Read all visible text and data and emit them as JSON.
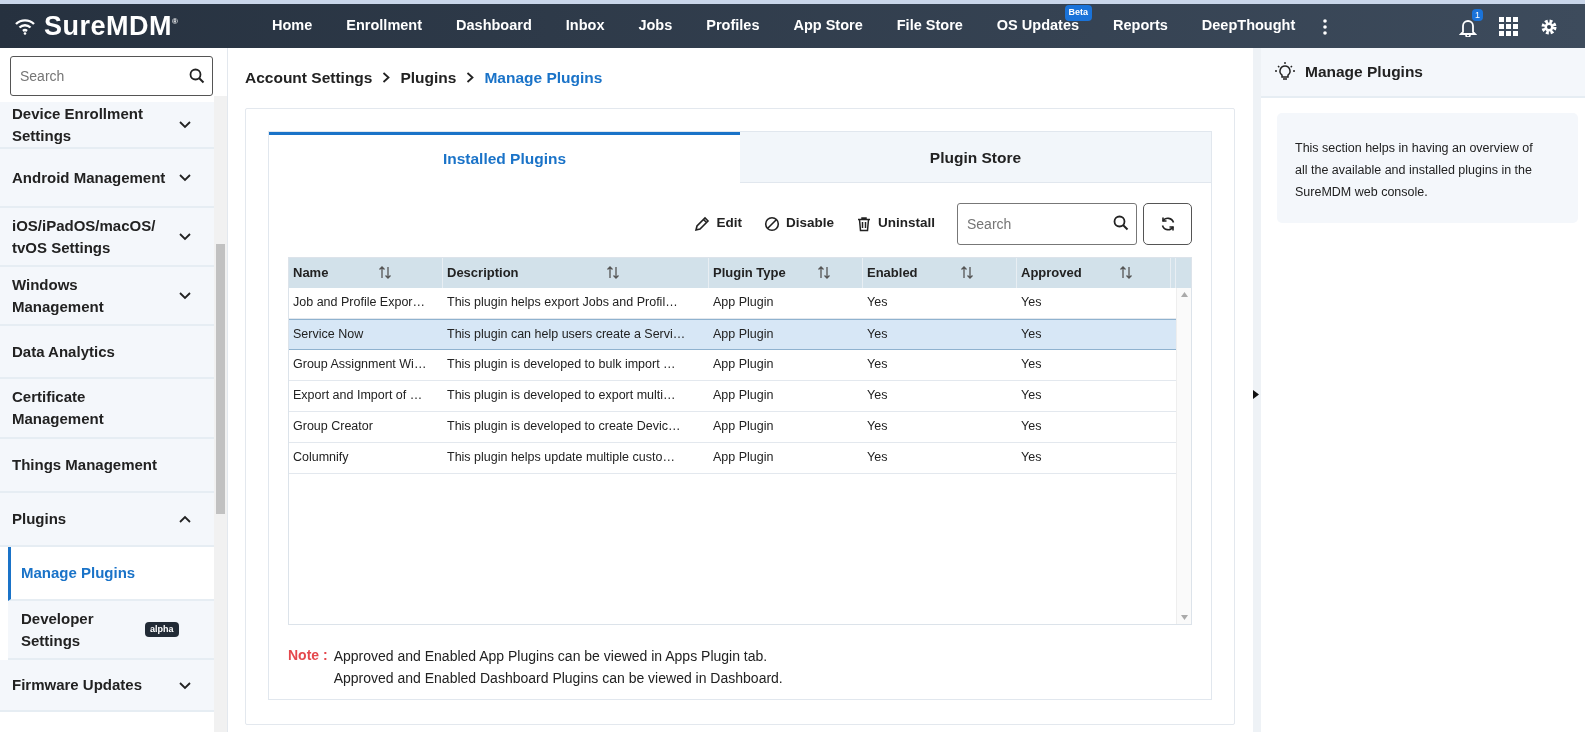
{
  "navbar": {
    "logo": "SureMDM",
    "logo_mark": "®",
    "notification_count": "1",
    "items": [
      {
        "label": "Home"
      },
      {
        "label": "Enrollment"
      },
      {
        "label": "Dashboard"
      },
      {
        "label": "Inbox"
      },
      {
        "label": "Jobs"
      },
      {
        "label": "Profiles"
      },
      {
        "label": "App Store"
      },
      {
        "label": "File Store"
      },
      {
        "label": "OS Updates",
        "badge": "Beta"
      },
      {
        "label": "Reports"
      },
      {
        "label": "DeepThought"
      }
    ]
  },
  "sidebar": {
    "search": {
      "placeholder": "Search"
    },
    "items": [
      {
        "label": "Device Enrollment Settings",
        "kind": "group",
        "expanded": false
      },
      {
        "label": "Android Management",
        "kind": "group",
        "expanded": false
      },
      {
        "label": "iOS/iPadOS/macOS/ tvOS Settings",
        "kind": "group",
        "expanded": false
      },
      {
        "label": "Windows Management",
        "kind": "group",
        "expanded": false
      },
      {
        "label": "Data Analytics",
        "kind": "link"
      },
      {
        "label": "Certificate Management",
        "kind": "link"
      },
      {
        "label": "Things Management",
        "kind": "link"
      },
      {
        "label": "Plugins",
        "kind": "group",
        "expanded": true,
        "children": [
          {
            "label": "Manage Plugins",
            "selected": true
          },
          {
            "label": "Developer Settings",
            "selected": false,
            "badge": "alpha"
          }
        ]
      },
      {
        "label": "Firmware Updates",
        "kind": "group",
        "expanded": false
      }
    ]
  },
  "breadcrumb": [
    {
      "label": "Account Settings",
      "current": false
    },
    {
      "label": "Plugins",
      "current": false
    },
    {
      "label": "Manage Plugins",
      "current": true
    }
  ],
  "tabs": [
    {
      "label": "Installed Plugins",
      "selected": true
    },
    {
      "label": "Plugin Store",
      "selected": false
    }
  ],
  "toolbar": {
    "actions": [
      {
        "label": "Edit",
        "kind": "edit"
      },
      {
        "label": "Disable",
        "kind": "disable"
      },
      {
        "label": "Uninstall",
        "kind": "uninstall"
      }
    ],
    "search": {
      "placeholder": "Search"
    }
  },
  "table": {
    "columns": [
      "Name",
      "Description",
      "Plugin Type",
      "Enabled",
      "Approved"
    ],
    "rows": [
      {
        "cells": [
          "Job and Profile Expor…",
          "This plugin helps export Jobs and Profil…",
          "App Plugin",
          "Yes",
          "Yes"
        ],
        "selected": false
      },
      {
        "cells": [
          "Service Now",
          "This plugin can help users create a Servi…",
          "App Plugin",
          "Yes",
          "Yes"
        ],
        "selected": true
      },
      {
        "cells": [
          "Group Assignment Wi…",
          "This plugin is developed to bulk import …",
          "App Plugin",
          "Yes",
          "Yes"
        ],
        "selected": false
      },
      {
        "cells": [
          "Export and Import of …",
          "This plugin is developed to export multi…",
          "App Plugin",
          "Yes",
          "Yes"
        ],
        "selected": false
      },
      {
        "cells": [
          "Group Creator",
          "This plugin is developed to create Devic…",
          "App Plugin",
          "Yes",
          "Yes"
        ],
        "selected": false
      },
      {
        "cells": [
          "Columnify",
          "This plugin helps update multiple custo…",
          "App Plugin",
          "Yes",
          "Yes"
        ],
        "selected": false
      }
    ]
  },
  "note": {
    "label": "Note :",
    "lines": [
      "Approved and Enabled App Plugins can be viewed in Apps Plugin tab.",
      "Approved and Enabled Dashboard Plugins can be viewed in Dashboard."
    ]
  },
  "help_panel": {
    "title": "Manage Plugins",
    "text": "This section helps in having an overview of all the available and installed plugins in the SureMDM web console."
  }
}
